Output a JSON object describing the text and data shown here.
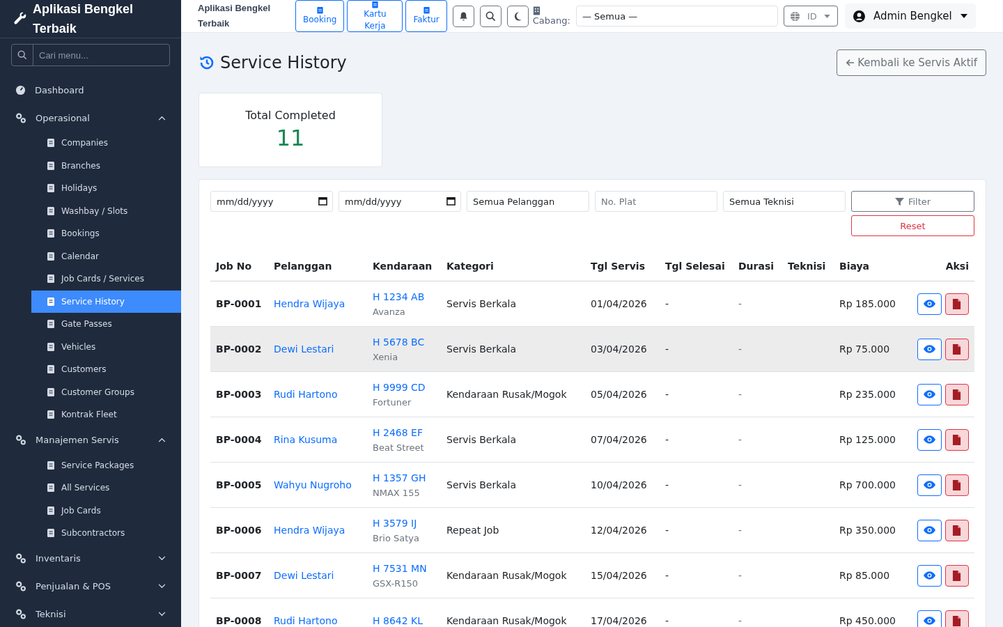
{
  "sidebar": {
    "brand": "Aplikasi Bengkel Terbaik",
    "search": {
      "placeholder": "Cari menu..."
    },
    "items": [
      {
        "label": "Dashboard",
        "kind": "link",
        "selected": false
      },
      {
        "label": "Operasional",
        "kind": "group",
        "expanded": true,
        "children": [
          {
            "label": "Companies",
            "selected": false
          },
          {
            "label": "Branches",
            "selected": false
          },
          {
            "label": "Holidays",
            "selected": false
          },
          {
            "label": "Washbay / Slots",
            "selected": false
          },
          {
            "label": "Bookings",
            "selected": false
          },
          {
            "label": "Calendar",
            "selected": false
          },
          {
            "label": "Job Cards / Services",
            "selected": false
          },
          {
            "label": "Service History",
            "selected": true
          },
          {
            "label": "Gate Passes",
            "selected": false
          },
          {
            "label": "Vehicles",
            "selected": false
          },
          {
            "label": "Customers",
            "selected": false
          },
          {
            "label": "Customer Groups",
            "selected": false
          },
          {
            "label": "Kontrak Fleet",
            "selected": false
          }
        ]
      },
      {
        "label": "Manajemen Servis",
        "kind": "group",
        "expanded": true,
        "children": [
          {
            "label": "Service Packages",
            "selected": false
          },
          {
            "label": "All Services",
            "selected": false
          },
          {
            "label": "Job Cards",
            "selected": false
          },
          {
            "label": "Subcontractors",
            "selected": false
          }
        ]
      },
      {
        "label": "Inventaris",
        "kind": "group",
        "expanded": false
      },
      {
        "label": "Penjualan & POS",
        "kind": "group",
        "expanded": false
      },
      {
        "label": "Teknisi",
        "kind": "group",
        "expanded": false
      }
    ]
  },
  "topbar": {
    "title": "Aplikasi Bengkel Terbaik",
    "quick_buttons": [
      "Booking",
      "Kartu Kerja",
      "Faktur"
    ],
    "branch_label": "Cabang:",
    "branch_value": "— Semua —",
    "language": "ID",
    "user": "Admin Bengkel"
  },
  "page": {
    "title": "Service History",
    "back_button": "Kembali ke Servis Aktif"
  },
  "stat": {
    "label": "Total Completed",
    "value": "11"
  },
  "filters": {
    "date_from": {
      "placeholder": "mm/dd/yyyy"
    },
    "date_to": {
      "placeholder": "mm/dd/yyyy"
    },
    "customer": "Semua Pelanggan",
    "plate": {
      "placeholder": "No. Plat"
    },
    "technician": "Semua Teknisi",
    "filter_button": "Filter",
    "reset_button": "Reset"
  },
  "table": {
    "columns": [
      "Job No",
      "Pelanggan",
      "Kendaraan",
      "Kategori",
      "Tgl Servis",
      "Tgl Selesai",
      "Durasi",
      "Teknisi",
      "Biaya",
      "Aksi"
    ],
    "rows": [
      {
        "job": "BP-0001",
        "customer": "Hendra Wijaya",
        "plate": "H 1234 AB",
        "model": "Avanza",
        "category": "Servis Berkala",
        "date": "01/04/2026",
        "done": "-",
        "duration": "-",
        "cost": "Rp 185.000",
        "selected": false
      },
      {
        "job": "BP-0002",
        "customer": "Dewi Lestari",
        "plate": "H 5678 BC",
        "model": "Xenia",
        "category": "Servis Berkala",
        "date": "03/04/2026",
        "done": "-",
        "duration": "-",
        "cost": "Rp 75.000",
        "selected": true
      },
      {
        "job": "BP-0003",
        "customer": "Rudi Hartono",
        "plate": "H 9999 CD",
        "model": "Fortuner",
        "category": "Kendaraan Rusak/Mogok",
        "date": "05/04/2026",
        "done": "-",
        "duration": "-",
        "cost": "Rp 235.000",
        "selected": false
      },
      {
        "job": "BP-0004",
        "customer": "Rina Kusuma",
        "plate": "H 2468 EF",
        "model": "Beat Street",
        "category": "Servis Berkala",
        "date": "07/04/2026",
        "done": "-",
        "duration": "-",
        "cost": "Rp 125.000",
        "selected": false
      },
      {
        "job": "BP-0005",
        "customer": "Wahyu Nugroho",
        "plate": "H 1357 GH",
        "model": "NMAX 155",
        "category": "Servis Berkala",
        "date": "10/04/2026",
        "done": "-",
        "duration": "-",
        "cost": "Rp 700.000",
        "selected": false
      },
      {
        "job": "BP-0006",
        "customer": "Hendra Wijaya",
        "plate": "H 3579 IJ",
        "model": "Brio Satya",
        "category": "Repeat Job",
        "date": "12/04/2026",
        "done": "-",
        "duration": "-",
        "cost": "Rp 350.000",
        "selected": false
      },
      {
        "job": "BP-0007",
        "customer": "Dewi Lestari",
        "plate": "H 7531 MN",
        "model": "GSX-R150",
        "category": "Kendaraan Rusak/Mogok",
        "date": "15/04/2026",
        "done": "-",
        "duration": "-",
        "cost": "Rp 85.000",
        "selected": false
      },
      {
        "job": "BP-0008",
        "customer": "Rudi Hartono",
        "plate": "H 8642 KL",
        "category": "Kendaraan Rusak/Mogok",
        "date": "17/04/2026",
        "done": "-",
        "duration": "-",
        "cost": "Rp 450.000",
        "selected": false
      }
    ]
  }
}
